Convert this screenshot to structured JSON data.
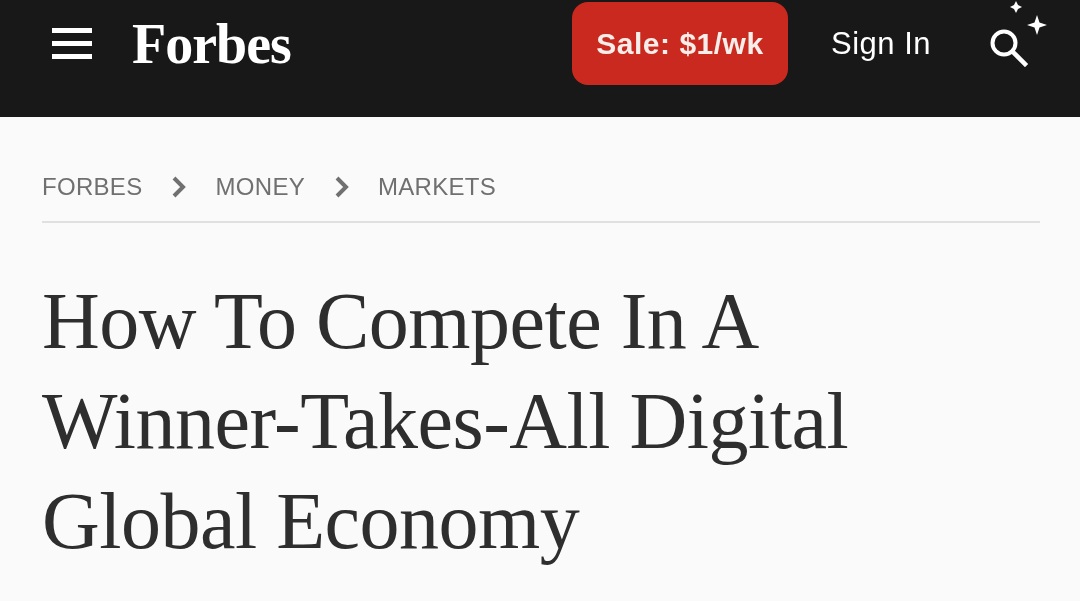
{
  "header": {
    "logo": "Forbes",
    "sale_button": "Sale: $1/wk",
    "sign_in": "Sign In"
  },
  "breadcrumb": [
    "FORBES",
    "MONEY",
    "MARKETS"
  ],
  "headline": "How To Compete In A Winner-Takes-All Digital Global Economy"
}
